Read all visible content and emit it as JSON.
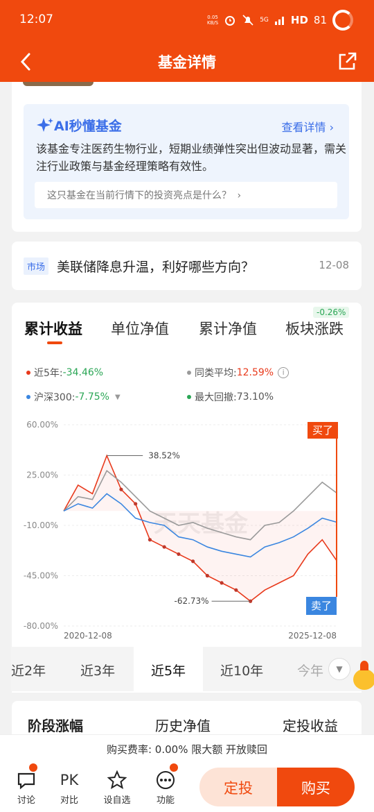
{
  "status": {
    "time": "12:07",
    "net_speed": "0.05\nKB/S",
    "signal": "5G",
    "hd": "HD",
    "battery": "81"
  },
  "nav": {
    "title": "基金详情"
  },
  "ai": {
    "title": "AI秒懂基金",
    "link": "查看详情",
    "text": "该基金专注医药生物行业，短期业绩弹性突出但波动显著，需关注行业政策与基金经理策略有效性。",
    "question": "这只基金在当前行情下的投资亮点是什么？"
  },
  "news": {
    "tag": "市场",
    "title": "美联储降息升温，利好哪些方向？",
    "date": "12-08"
  },
  "tabs": [
    "累计收益",
    "单位净值",
    "累计净值",
    "板块涨跌"
  ],
  "sector_badge": "-0.26%",
  "legend": {
    "fund_label": "近5年:",
    "fund_value": "-34.46%",
    "avg_label": "同类平均:",
    "avg_value": "12.59%",
    "index_label": "沪深300:",
    "index_value": "-7.75%",
    "dd_label": "最大回撤:",
    "dd_value": "73.10%"
  },
  "chart_data": {
    "type": "line",
    "x_start": "2020-12-08",
    "x_end": "2025-12-08",
    "y_ticks": [
      "60.00%",
      "25.00%",
      "-10.00%",
      "-45.00%",
      "-80.00%"
    ],
    "ylim": [
      -80,
      60
    ],
    "peak_label": "38.52%",
    "trough_label": "-62.73%",
    "buy_label": "买了",
    "sell_label": "卖了",
    "watermark": "天天基金",
    "series": [
      {
        "name": "近5年",
        "color": "#e8391b",
        "values": [
          0,
          18,
          12,
          38.52,
          15,
          5,
          -20,
          -25,
          -30,
          -35,
          -45,
          -50,
          -55,
          -62.73,
          -55,
          -50,
          -45,
          -30,
          -20,
          -34.46
        ]
      },
      {
        "name": "同类平均",
        "color": "#9a9a9a",
        "values": [
          0,
          10,
          8,
          28,
          20,
          10,
          0,
          -5,
          -10,
          -8,
          -12,
          -15,
          -18,
          -20,
          -10,
          -8,
          0,
          10,
          20,
          12.59
        ]
      },
      {
        "name": "沪深300",
        "color": "#3a86e0",
        "values": [
          0,
          5,
          2,
          12,
          5,
          -5,
          -8,
          -10,
          -18,
          -20,
          -25,
          -28,
          -30,
          -32,
          -25,
          -22,
          -18,
          -12,
          -5,
          -7.75
        ]
      }
    ]
  },
  "periods": [
    "近2年",
    "近3年",
    "近5年",
    "近10年",
    "今年"
  ],
  "section_tabs": [
    "阶段涨幅",
    "历史净值",
    "定投收益"
  ],
  "fee": "购买费率: 0.00% 限大额 开放赎回",
  "toolbar": {
    "discuss": "讨论",
    "pk_icon": "PK",
    "compare": "对比",
    "watch": "设自选",
    "func": "功能"
  },
  "buttons": {
    "dingtou": "定投",
    "buy": "购买"
  }
}
